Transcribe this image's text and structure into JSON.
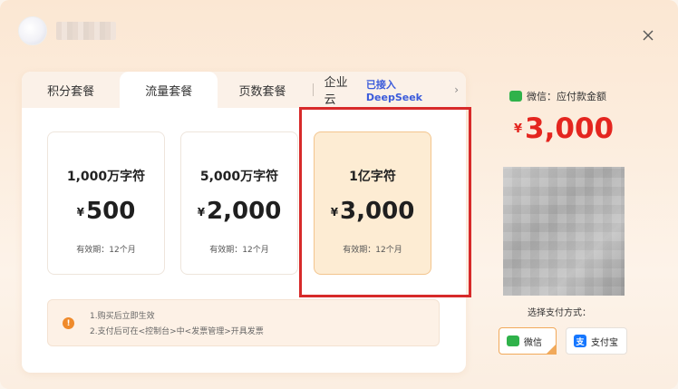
{
  "header": {
    "close_icon": "close-icon"
  },
  "tabs": [
    {
      "label": "积分套餐"
    },
    {
      "label": "流量套餐"
    },
    {
      "label": "页数套餐"
    },
    {
      "label": "企业云",
      "badge": "已接入DeepSeek"
    }
  ],
  "plans": [
    {
      "title": "1,000万字符",
      "currency": "¥",
      "price": "500",
      "validity": "有效期：12个月"
    },
    {
      "title": "5,000万字符",
      "currency": "¥",
      "price": "2,000",
      "validity": "有效期：12个月"
    },
    {
      "title": "1亿字符",
      "currency": "¥",
      "price": "3,000",
      "validity": "有效期：12个月",
      "selected": true
    }
  ],
  "notice": {
    "line1": "1.购买后立即生效",
    "line2": "2.支付后可在<控制台>中<发票管理>开具发票"
  },
  "payment": {
    "label": "微信：应付款金额",
    "currency": "¥",
    "amount": "3,000",
    "method_title": "选择支付方式：",
    "wechat_label": "微信",
    "alipay_label": "支付宝"
  },
  "colors": {
    "accent": "#e4251f",
    "highlight": "#d72a2a",
    "wechat": "#2fb24a",
    "alipay": "#1677ff"
  }
}
